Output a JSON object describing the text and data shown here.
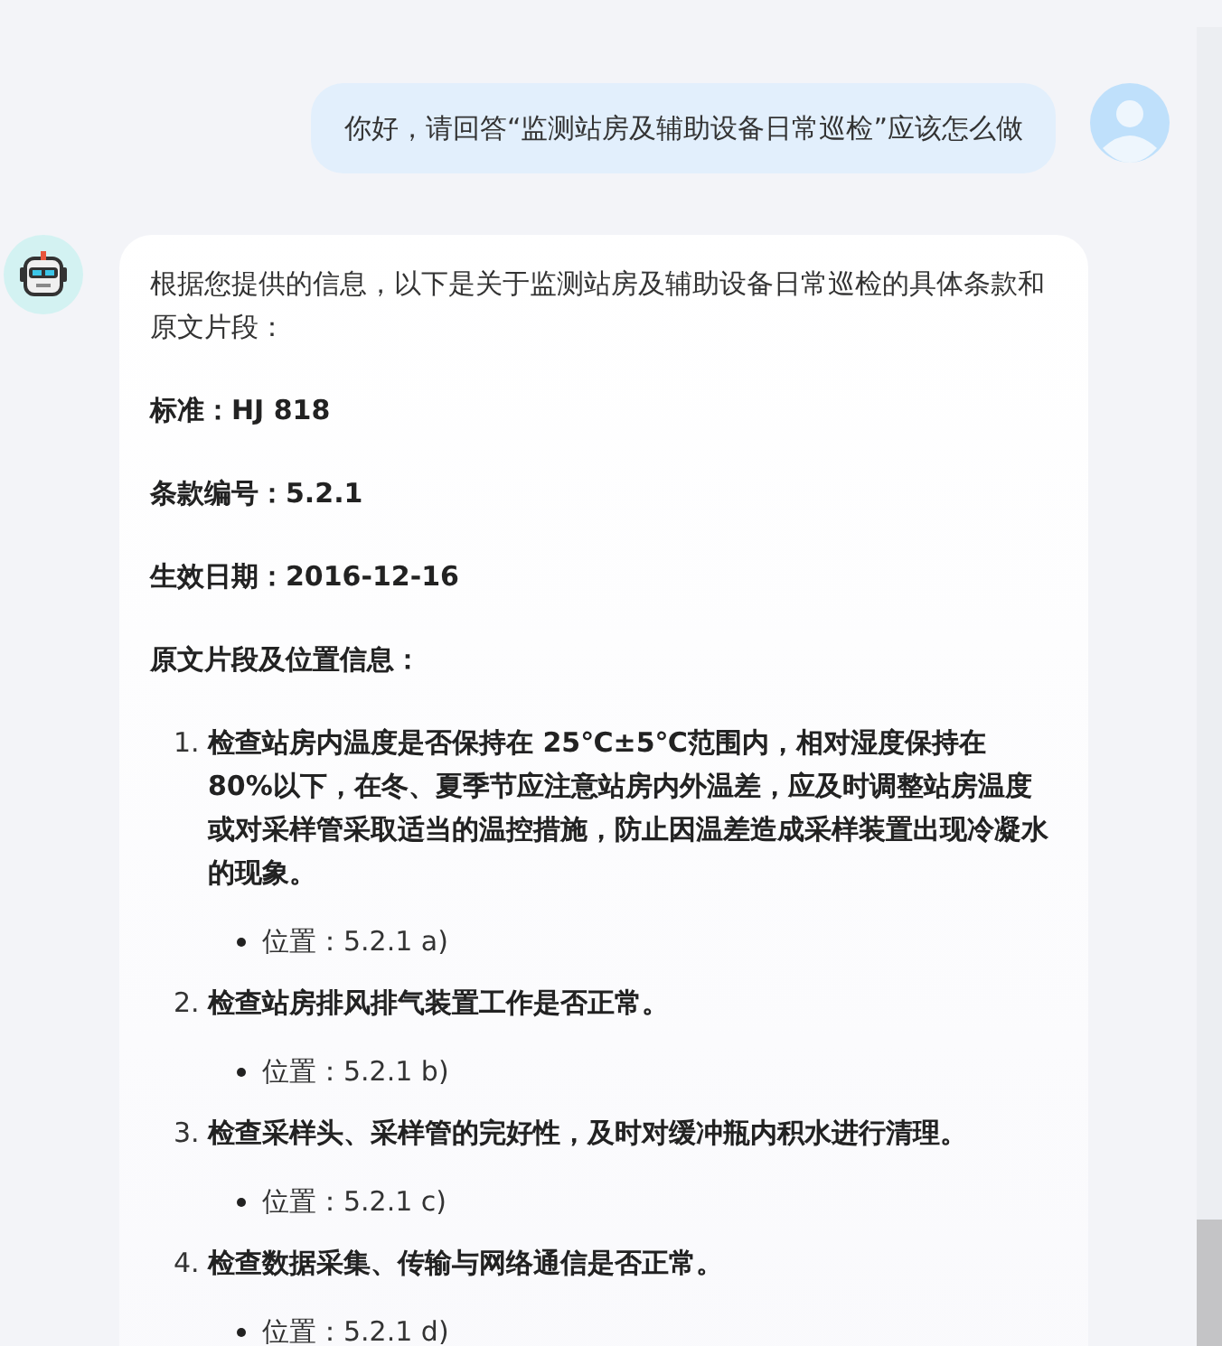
{
  "user_message": {
    "text": "你好，请回答“监测站房及辅助设备日常巡检”应该怎么做"
  },
  "bot_message": {
    "intro": "根据您提供的信息，以下是关于监测站房及辅助设备日常巡检的具体条款和原文片段：",
    "fields": [
      "标准：HJ 818",
      "条款编号：5.2.1",
      "生效日期：2016-12-16"
    ],
    "section_heading": "原文片段及位置信息：",
    "items": [
      {
        "number": "1.",
        "text": "检查站房内温度是否保持在 25℃±5℃范围内，相对湿度保持在 80%以下，在冬、夏季节应注意站房内外温差，应及时调整站房温度或对采样管采取适当的温控措施，防止因温差造成采样装置出现冷凝水的现象。",
        "location": "位置：5.2.1 a)"
      },
      {
        "number": "2.",
        "text": "检查站房排风排气装置工作是否正常。",
        "location": "位置：5.2.1 b)"
      },
      {
        "number": "3.",
        "text": "检查采样头、采样管的完好性，及时对缓冲瓶内积水进行清理。",
        "location": "位置：5.2.1 c)"
      },
      {
        "number": "4.",
        "text": "检查数据采集、传输与网络通信是否正常。",
        "location": "位置：5.2.1 d)"
      }
    ]
  }
}
